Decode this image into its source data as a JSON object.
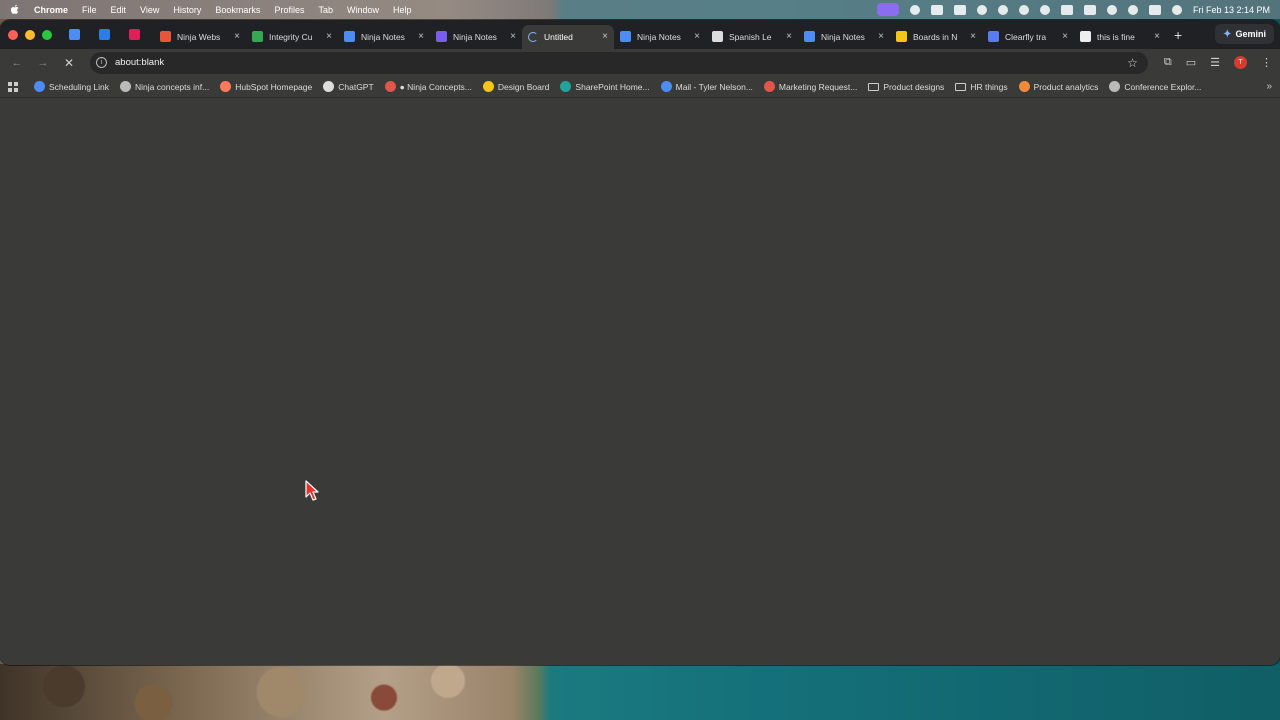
{
  "menubar": {
    "app": "Chrome",
    "items": [
      "File",
      "Edit",
      "View",
      "History",
      "Bookmarks",
      "Profiles",
      "Tab",
      "Window",
      "Help"
    ],
    "clock": "Fri Feb 13  2:14 PM"
  },
  "tabs": [
    {
      "label": "Ninja Webs",
      "favicon_color": "#e8553a"
    },
    {
      "label": "Integrity Cu",
      "favicon_color": "#34a853"
    },
    {
      "label": "Ninja Notes",
      "favicon_color": "#4d8bf5"
    },
    {
      "label": "Ninja Notes",
      "favicon_color": "#7a5cf0"
    },
    {
      "label": "Untitled",
      "favicon_color": "#8ab4f8",
      "active": true,
      "loading": true
    },
    {
      "label": "Ninja Notes",
      "favicon_color": "#4d8bf5"
    },
    {
      "label": "Spanish Le",
      "favicon_color": "#dddddd"
    },
    {
      "label": "Ninja Notes",
      "favicon_color": "#4d8bf5"
    },
    {
      "label": "Boards in N",
      "favicon_color": "#f5c518"
    },
    {
      "label": "Clearfly tra",
      "favicon_color": "#5b7cf0"
    },
    {
      "label": "this is fine",
      "favicon_color": "#eeeeee"
    }
  ],
  "gemini_label": "Gemini",
  "omnibox": {
    "url": "about:blank"
  },
  "bookmarks": [
    {
      "label": "Scheduling Link",
      "icon": "#4d8bf5"
    },
    {
      "label": "Ninja concepts inf...",
      "icon": "#bbbbbb"
    },
    {
      "label": "HubSpot Homepage",
      "icon": "#ff7a59"
    },
    {
      "label": "ChatGPT",
      "icon": "#dddddd"
    },
    {
      "label": "● Ninja Concepts...",
      "icon": "#e0564a"
    },
    {
      "label": "Design Board",
      "icon": "#f5c518"
    },
    {
      "label": "SharePoint Home...",
      "icon": "#1fa39a"
    },
    {
      "label": "Mail - Tyler Nelson...",
      "icon": "#4d8bf5"
    },
    {
      "label": "Marketing Request...",
      "icon": "#e0564a"
    },
    {
      "label": "Product designs",
      "icon": "folder"
    },
    {
      "label": "HR things",
      "icon": "folder"
    },
    {
      "label": "Product analytics",
      "icon": "#f08a3a"
    },
    {
      "label": "Conference Explor...",
      "icon": "#bbbbbb"
    }
  ],
  "profile_initial": "T"
}
